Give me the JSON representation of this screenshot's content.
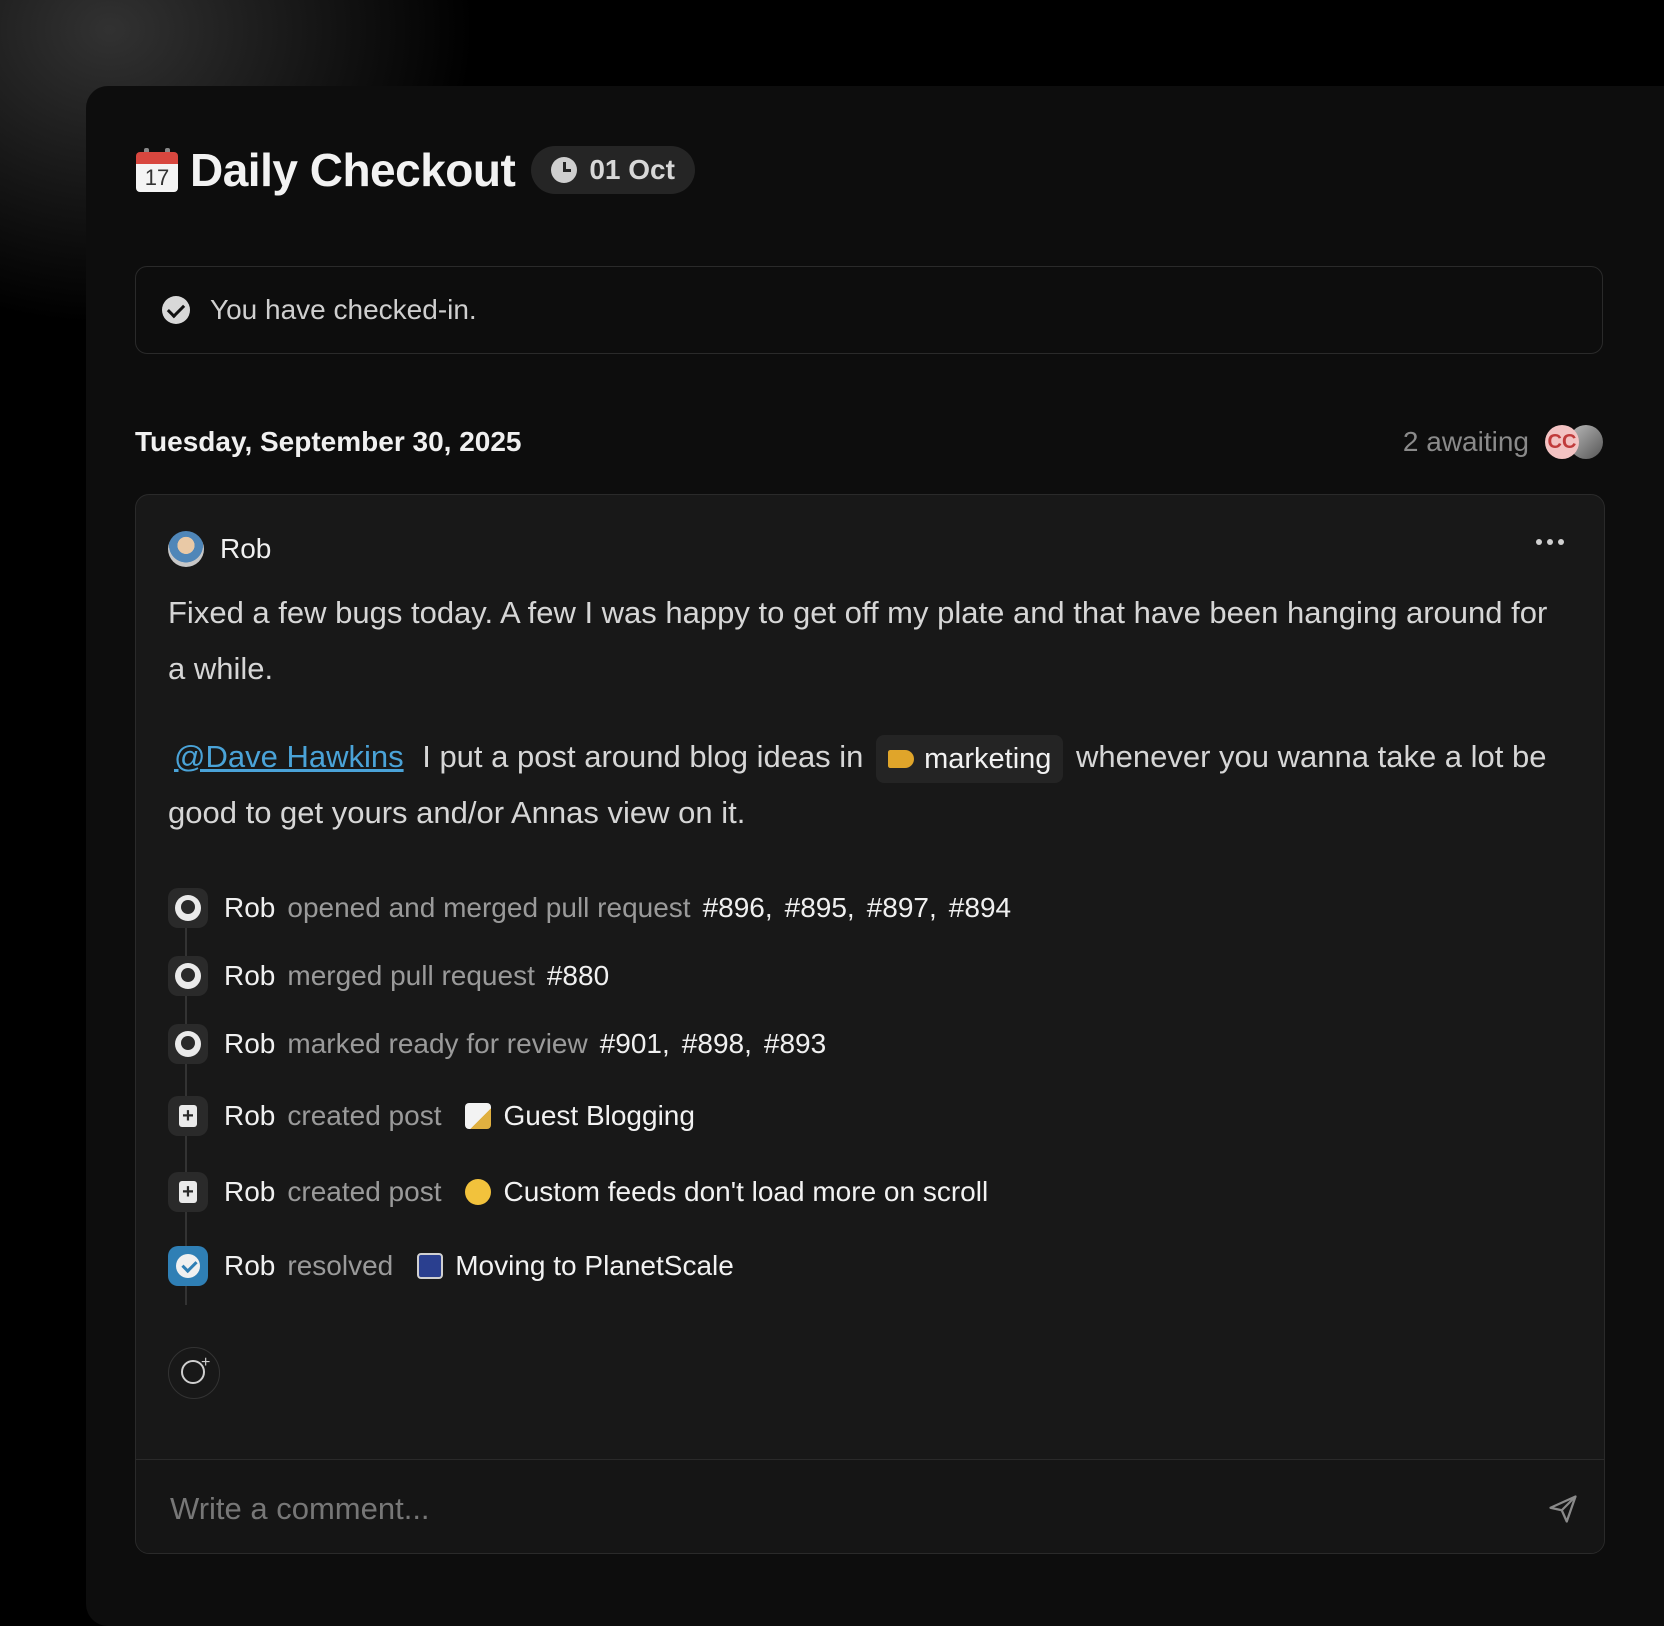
{
  "header": {
    "title": "Daily Checkout",
    "calendar_icon_text": "17",
    "date_badge": "01 Oct"
  },
  "checkin": {
    "text": "You have checked-in."
  },
  "day": {
    "label": "Tuesday, September 30, 2025",
    "awaiting_text": "2 awaiting",
    "awaiting_avatar_initials": "CC"
  },
  "post": {
    "author": "Rob",
    "paragraph1": "Fixed a few bugs today. A few I was happy to get off my plate and that have been hanging around for a while.",
    "mention": "@Dave Hawkins",
    "paragraph2_before_channel": "I put a post around blog ideas in",
    "channel": "marketing",
    "paragraph2_after_channel": "whenever you wanna take a lot be good to get yours and/or Annas view on it."
  },
  "activity": [
    {
      "icon": "github-icon",
      "actor": "Rob",
      "verb": "opened and merged pull request",
      "items": [
        "#896,",
        "#895,",
        "#897,",
        "#894"
      ]
    },
    {
      "icon": "github-icon",
      "actor": "Rob",
      "verb": "merged pull request",
      "items": [
        "#880"
      ]
    },
    {
      "icon": "github-icon",
      "actor": "Rob",
      "verb": "marked ready for review",
      "items": [
        "#901,",
        "#898,",
        "#893"
      ]
    },
    {
      "icon": "new-post-icon",
      "actor": "Rob",
      "verb": "created post",
      "post_emoji": "memo-emoji",
      "post_title": "Guest Blogging"
    },
    {
      "icon": "new-post-icon",
      "actor": "Rob",
      "verb": "created post",
      "post_emoji": "confused-face-emoji",
      "post_title": "Custom feeds don't load more on scroll"
    },
    {
      "icon": "resolved-check-icon",
      "actor": "Rob",
      "verb": "resolved",
      "post_emoji": "chart-emoji",
      "post_title": "Moving to PlanetScale"
    }
  ],
  "comment": {
    "placeholder": "Write a comment..."
  },
  "colors": {
    "window_bg": "#0d0d0d",
    "card_bg": "#181818",
    "mention": "#4aa3d8",
    "resolved_accent": "#2f7fb5"
  }
}
